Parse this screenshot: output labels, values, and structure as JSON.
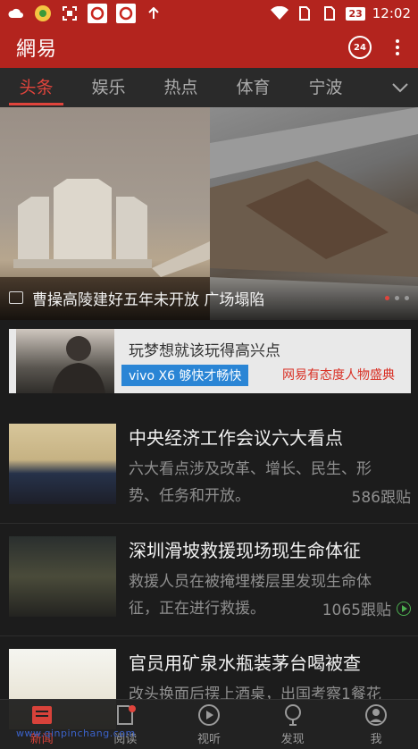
{
  "status_bar": {
    "battery": "23",
    "time": "12:02"
  },
  "app": {
    "logo": "網易",
    "hot_badge": "24"
  },
  "tabs": [
    {
      "label": "头条",
      "active": true
    },
    {
      "label": "娱乐"
    },
    {
      "label": "热点"
    },
    {
      "label": "体育"
    },
    {
      "label": "宁波"
    }
  ],
  "hero": {
    "caption": "曹操高陵建好五年未开放 广场塌陷"
  },
  "ad": {
    "title": "玩梦想就该玩得高兴点",
    "vivo": "vivo X6 够快才畅快",
    "sub": "网易有态度人物盛典"
  },
  "news": [
    {
      "title": "中央经济工作会议六大看点",
      "desc": "六大看点涉及改革、增长、民生、形势、任务和开放。",
      "replies": "586跟贴",
      "video": false
    },
    {
      "title": "深圳滑坡救援现场现生命体征",
      "desc": "救援人员在被掩埋楼层里发现生命体征，正在进行救援。",
      "replies": "1065跟贴",
      "video": true
    },
    {
      "title": "官员用矿泉水瓶装茅台喝被查",
      "desc": "改头换面后摆上酒桌，出国考察1餐花",
      "replies": "",
      "video": false
    }
  ],
  "bottom_nav": [
    {
      "label": "新闻",
      "icon": "newspaper-icon",
      "active": true
    },
    {
      "label": "阅读",
      "icon": "read-icon",
      "badge": true
    },
    {
      "label": "视听",
      "icon": "play-icon"
    },
    {
      "label": "发现",
      "icon": "discover-icon"
    },
    {
      "label": "我",
      "icon": "user-icon"
    }
  ],
  "watermark": "www.qinpinchang.com",
  "colors": {
    "brand": "#b3241e",
    "accent": "#e0443c",
    "background": "#1c1c1c"
  }
}
